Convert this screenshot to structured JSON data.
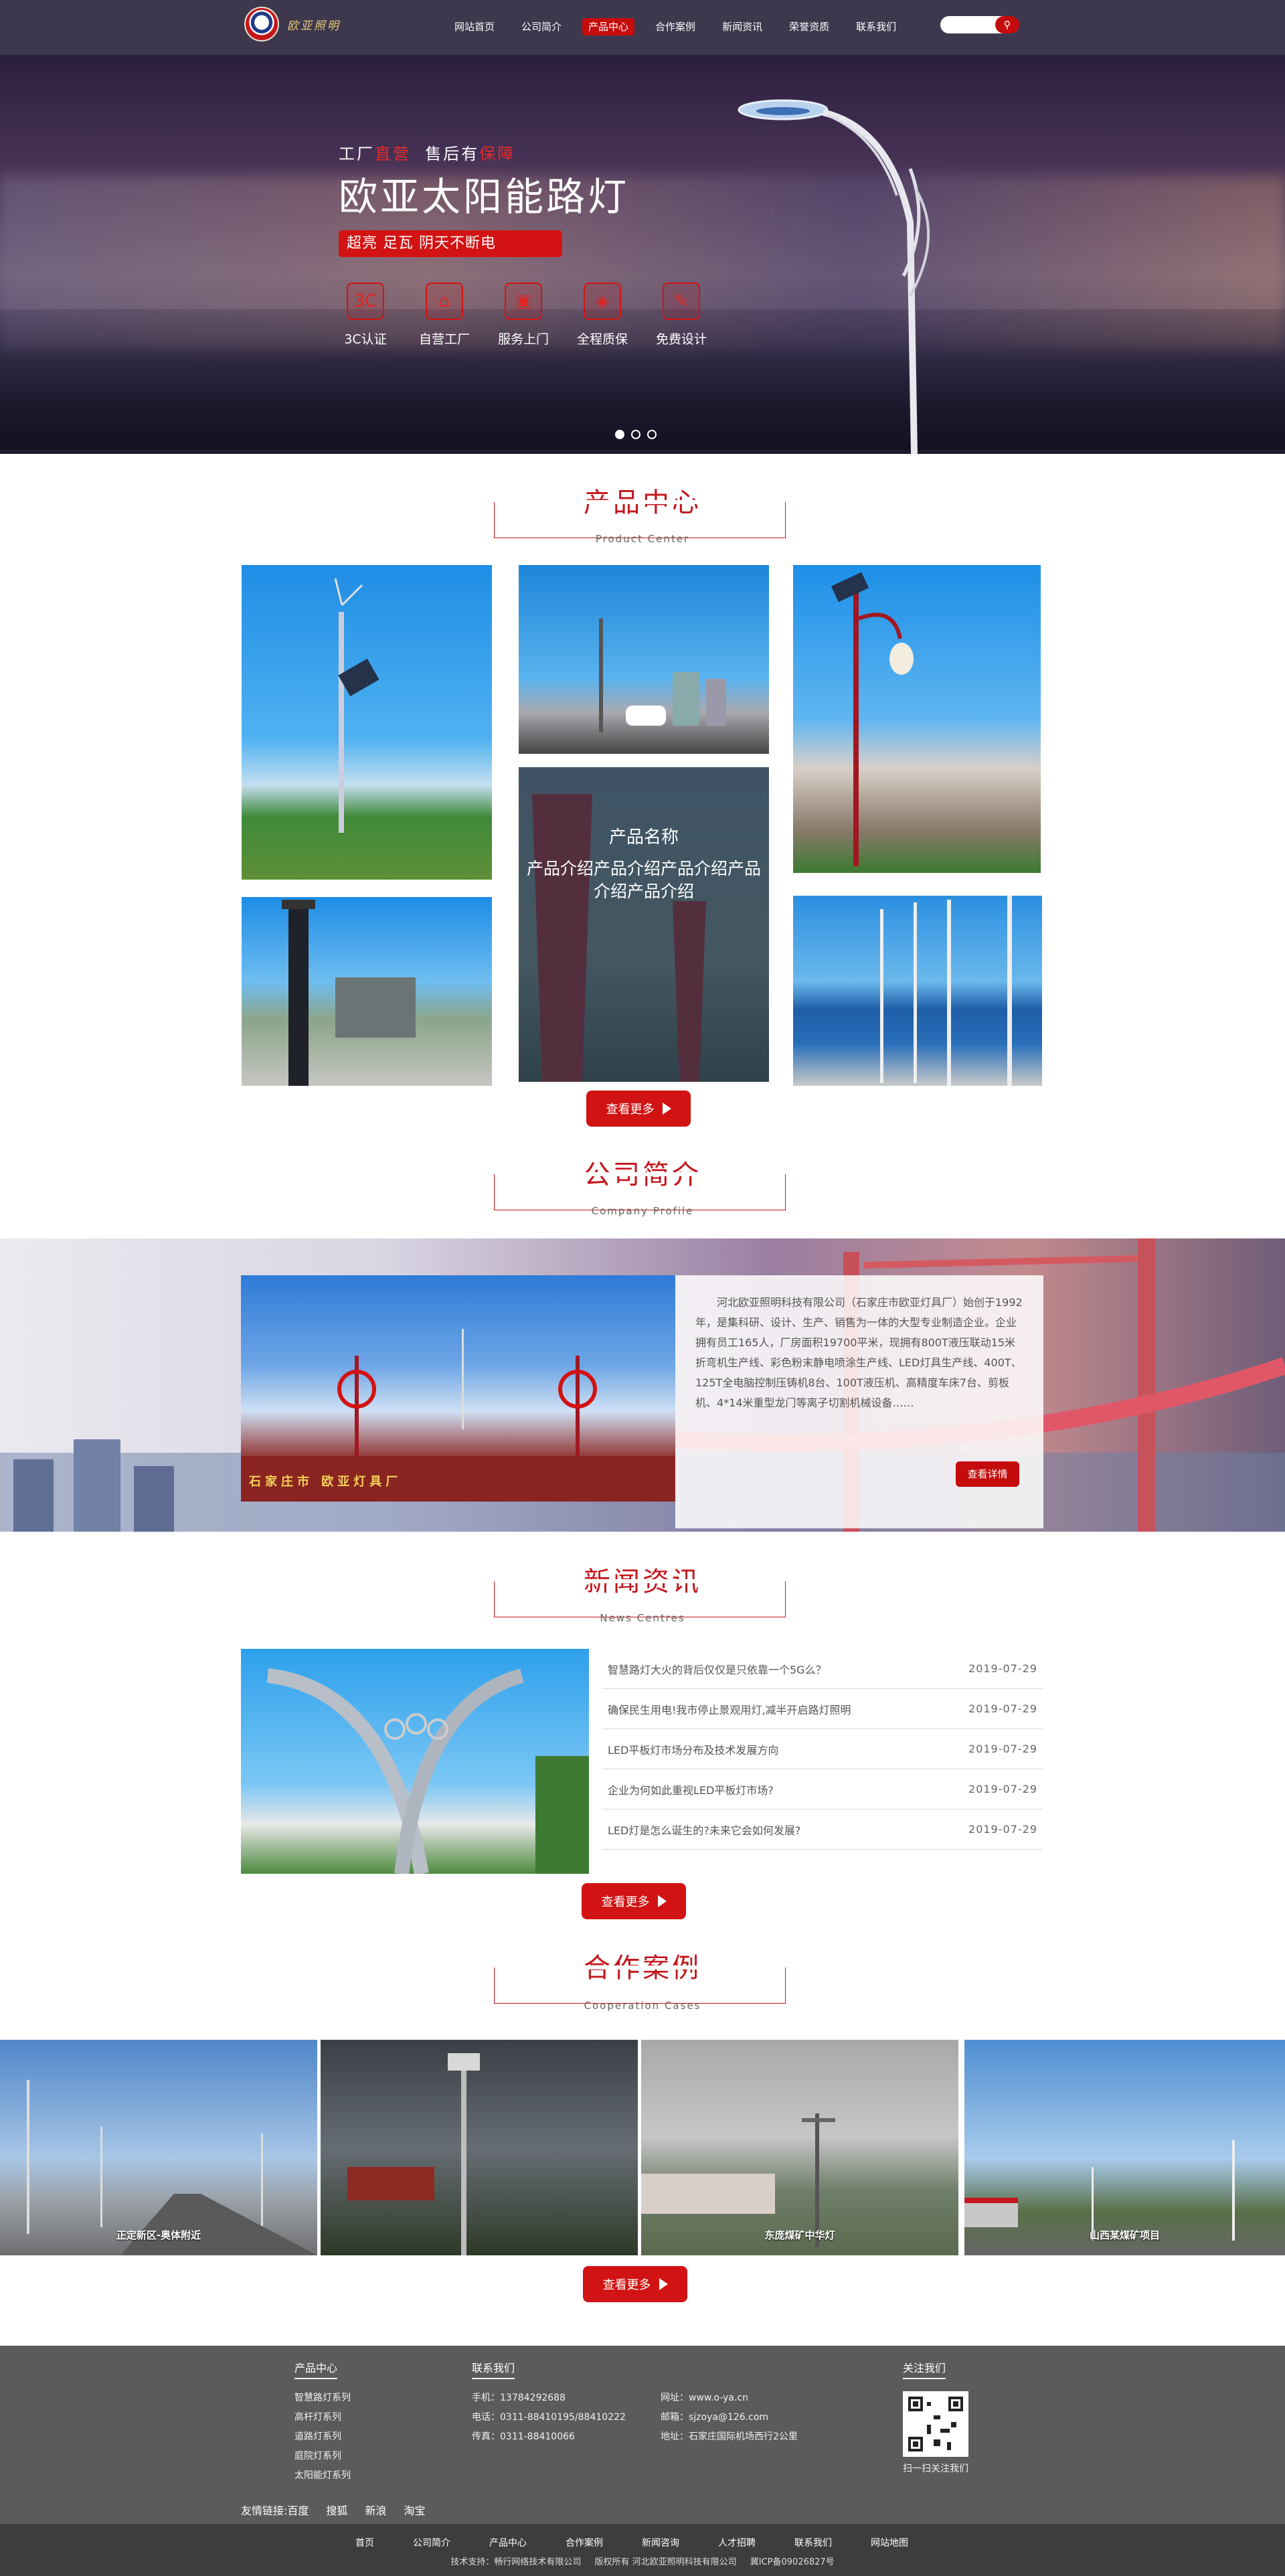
{
  "header": {
    "logo_text": "欧亚照明",
    "nav": [
      "网站首页",
      "公司简介",
      "产品中心",
      "合作案例",
      "新闻资讯",
      "荣誉资质",
      "联系我们"
    ],
    "active_nav": "产品中心",
    "search_placeholder": ""
  },
  "banner": {
    "tagline_1": "工厂",
    "tagline_hl1": "直营",
    "tagline_2": "售后有",
    "tagline_hl2": "保障",
    "title": "欧亚太阳能路灯",
    "slogan": "超亮 足瓦 阴天不断电",
    "features": [
      {
        "icon": "certificate-icon",
        "glyph": "3C",
        "label": "3C认证"
      },
      {
        "icon": "factory-icon",
        "glyph": "⌂",
        "label": "自营工厂"
      },
      {
        "icon": "truck-icon",
        "glyph": "▣",
        "label": "服务上门"
      },
      {
        "icon": "shield-icon",
        "glyph": "◈",
        "label": "全程质保"
      },
      {
        "icon": "pen-icon",
        "glyph": "✎",
        "label": "免费设计"
      }
    ],
    "slide_count": 3,
    "active_slide": 1
  },
  "products": {
    "title": "产品中心",
    "subtitle": "Product Center",
    "featured_name": "产品名称",
    "featured_desc": "产品介绍产品介绍产品介绍产品介绍产品介绍",
    "more": "查看更多"
  },
  "about": {
    "title": "公司简介",
    "subtitle": "Company Profile",
    "text": "河北欧亚照明科技有限公司（石家庄市欧亚灯具厂）始创于1992年，是集科研、设计、生产、销售为一体的大型专业制造企业。企业拥有员工165人，厂房面积19700平米，现拥有800T液压联动15米折弯机生产线、彩色粉末静电喷涂生产线、LED灯具生产线、400T、125T全电脑控制压铸机8台、100T液压机、高精度车床7台、剪板机、4*14米重型龙门等离子切割机械设备……",
    "detail": "查看详情",
    "image_caption": "石家庄市 欧亚灯具厂"
  },
  "news": {
    "title": "新闻资讯",
    "subtitle": "News Centres",
    "items": [
      {
        "title": "智慧路灯大火的背后仅仅是只依靠一个5G么？",
        "date": "2019-07-29"
      },
      {
        "title": "确保民生用电!我市停止景观用灯,减半开启路灯照明",
        "date": "2019-07-29"
      },
      {
        "title": "LED平板灯市场分布及技术发展方向",
        "date": "2019-07-29"
      },
      {
        "title": "企业为何如此重视LED平板灯市场?",
        "date": "2019-07-29"
      },
      {
        "title": "LED灯是怎么诞生的?未来它会如何发展?",
        "date": "2019-07-29"
      }
    ],
    "more": "查看更多"
  },
  "cases": {
    "title": "合作案例",
    "subtitle": "Cooperation Cases",
    "items": [
      "正定新区-奥体附近",
      "",
      "东庞煤矿中华灯",
      "山西某煤矿项目"
    ],
    "more": "查看更多"
  },
  "footer": {
    "products_head": "产品中心",
    "products": [
      "智慧路灯系列",
      "高杆灯系列",
      "道路灯系列",
      "庭院灯系列",
      "太阳能灯系列"
    ],
    "contact_head": "联系我们",
    "contact_left": [
      "手机：13784292688",
      "电话：0311-88410195/88410222",
      "传真：0311-88410066"
    ],
    "contact_right": [
      "网址：www.o-ya.cn",
      "邮箱：sjzoya@126.com",
      "地址：石家庄国际机场西行2公里"
    ],
    "follow_head": "关注我们",
    "follow_caption": "扫一扫关注我们",
    "friend_label": "友情链接:",
    "friends": [
      "百度",
      "搜狐",
      "新浪",
      "淘宝"
    ]
  },
  "bottom": {
    "nav": [
      "首页",
      "公司简介",
      "产品中心",
      "合作案例",
      "新闻咨询",
      "人才招聘",
      "联系我们",
      "网站地图"
    ],
    "support": "技术支持：畅行网络技术有限公司",
    "copyright": "版权所有 河北欧亚照明科技有限公司",
    "icp": "冀ICP备09026827号"
  },
  "colors": {
    "brand_red": "#c4161c",
    "header_bg": "#221c34",
    "footer_bg": "#5b5b5b",
    "bottom_bg": "#3d3d3d"
  }
}
